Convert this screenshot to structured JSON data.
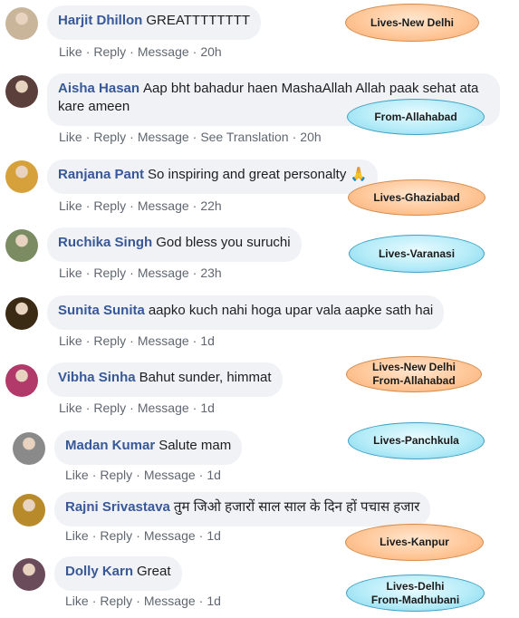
{
  "actions": {
    "like": "Like",
    "reply": "Reply",
    "message": "Message",
    "see_translation": "See Translation"
  },
  "comments": [
    {
      "author": "Harjit Dhillon",
      "text": "GREATTTTTTTT",
      "time": "20h",
      "tag_lines": [
        "Lives-New Delhi"
      ],
      "tag_color": "orange",
      "avatar_color": "#c9b59a"
    },
    {
      "author": "Aisha Hasan",
      "text": "Aap bht bahadur haen MashaAllah Allah paak sehat ata kare ameen",
      "time": "20h",
      "tag_lines": [
        "From-Allahabad"
      ],
      "tag_color": "blue",
      "avatar_color": "#5a3f3a"
    },
    {
      "author": "Ranjana Pant",
      "text": "So inspiring and great personalty 🙏",
      "time": "22h",
      "tag_lines": [
        "Lives-Ghaziabad"
      ],
      "tag_color": "orange",
      "avatar_color": "#d6a13a"
    },
    {
      "author": "Ruchika Singh",
      "text": "God bless you suruchi",
      "time": "23h",
      "tag_lines": [
        "Lives-Varanasi"
      ],
      "tag_color": "blue",
      "avatar_color": "#7b8c62"
    },
    {
      "author": "Sunita Sunita",
      "text": "aapko kuch nahi hoga upar vala aapke sath hai",
      "time": "1d",
      "tag_lines": [],
      "tag_color": "",
      "avatar_color": "#3b2a14"
    },
    {
      "author": "Vibha Sinha",
      "text": "Bahut sunder, himmat",
      "time": "1d",
      "tag_lines": [
        "Lives-New Delhi",
        "From-Allahabad"
      ],
      "tag_color": "orange",
      "avatar_color": "#b23a6a"
    },
    {
      "author": "Madan Kumar",
      "text": "Salute mam",
      "time": "1d",
      "tag_lines": [
        "Lives-Panchkula"
      ],
      "tag_color": "blue",
      "avatar_color": "#8a8a8a"
    },
    {
      "author": "Rajni Srivastava",
      "text": "तुम जिओ हजारों साल साल के दिन हों पचास हजार",
      "time": "1d",
      "tag_lines": [
        "Lives-Kanpur"
      ],
      "tag_color": "orange",
      "avatar_color": "#b88a2a"
    },
    {
      "author": "Dolly Karn",
      "text": "Great",
      "time": "1d",
      "tag_lines": [
        "Lives-Delhi",
        "From-Madhubani"
      ],
      "tag_color": "blue",
      "avatar_color": "#6a4b5a"
    }
  ]
}
